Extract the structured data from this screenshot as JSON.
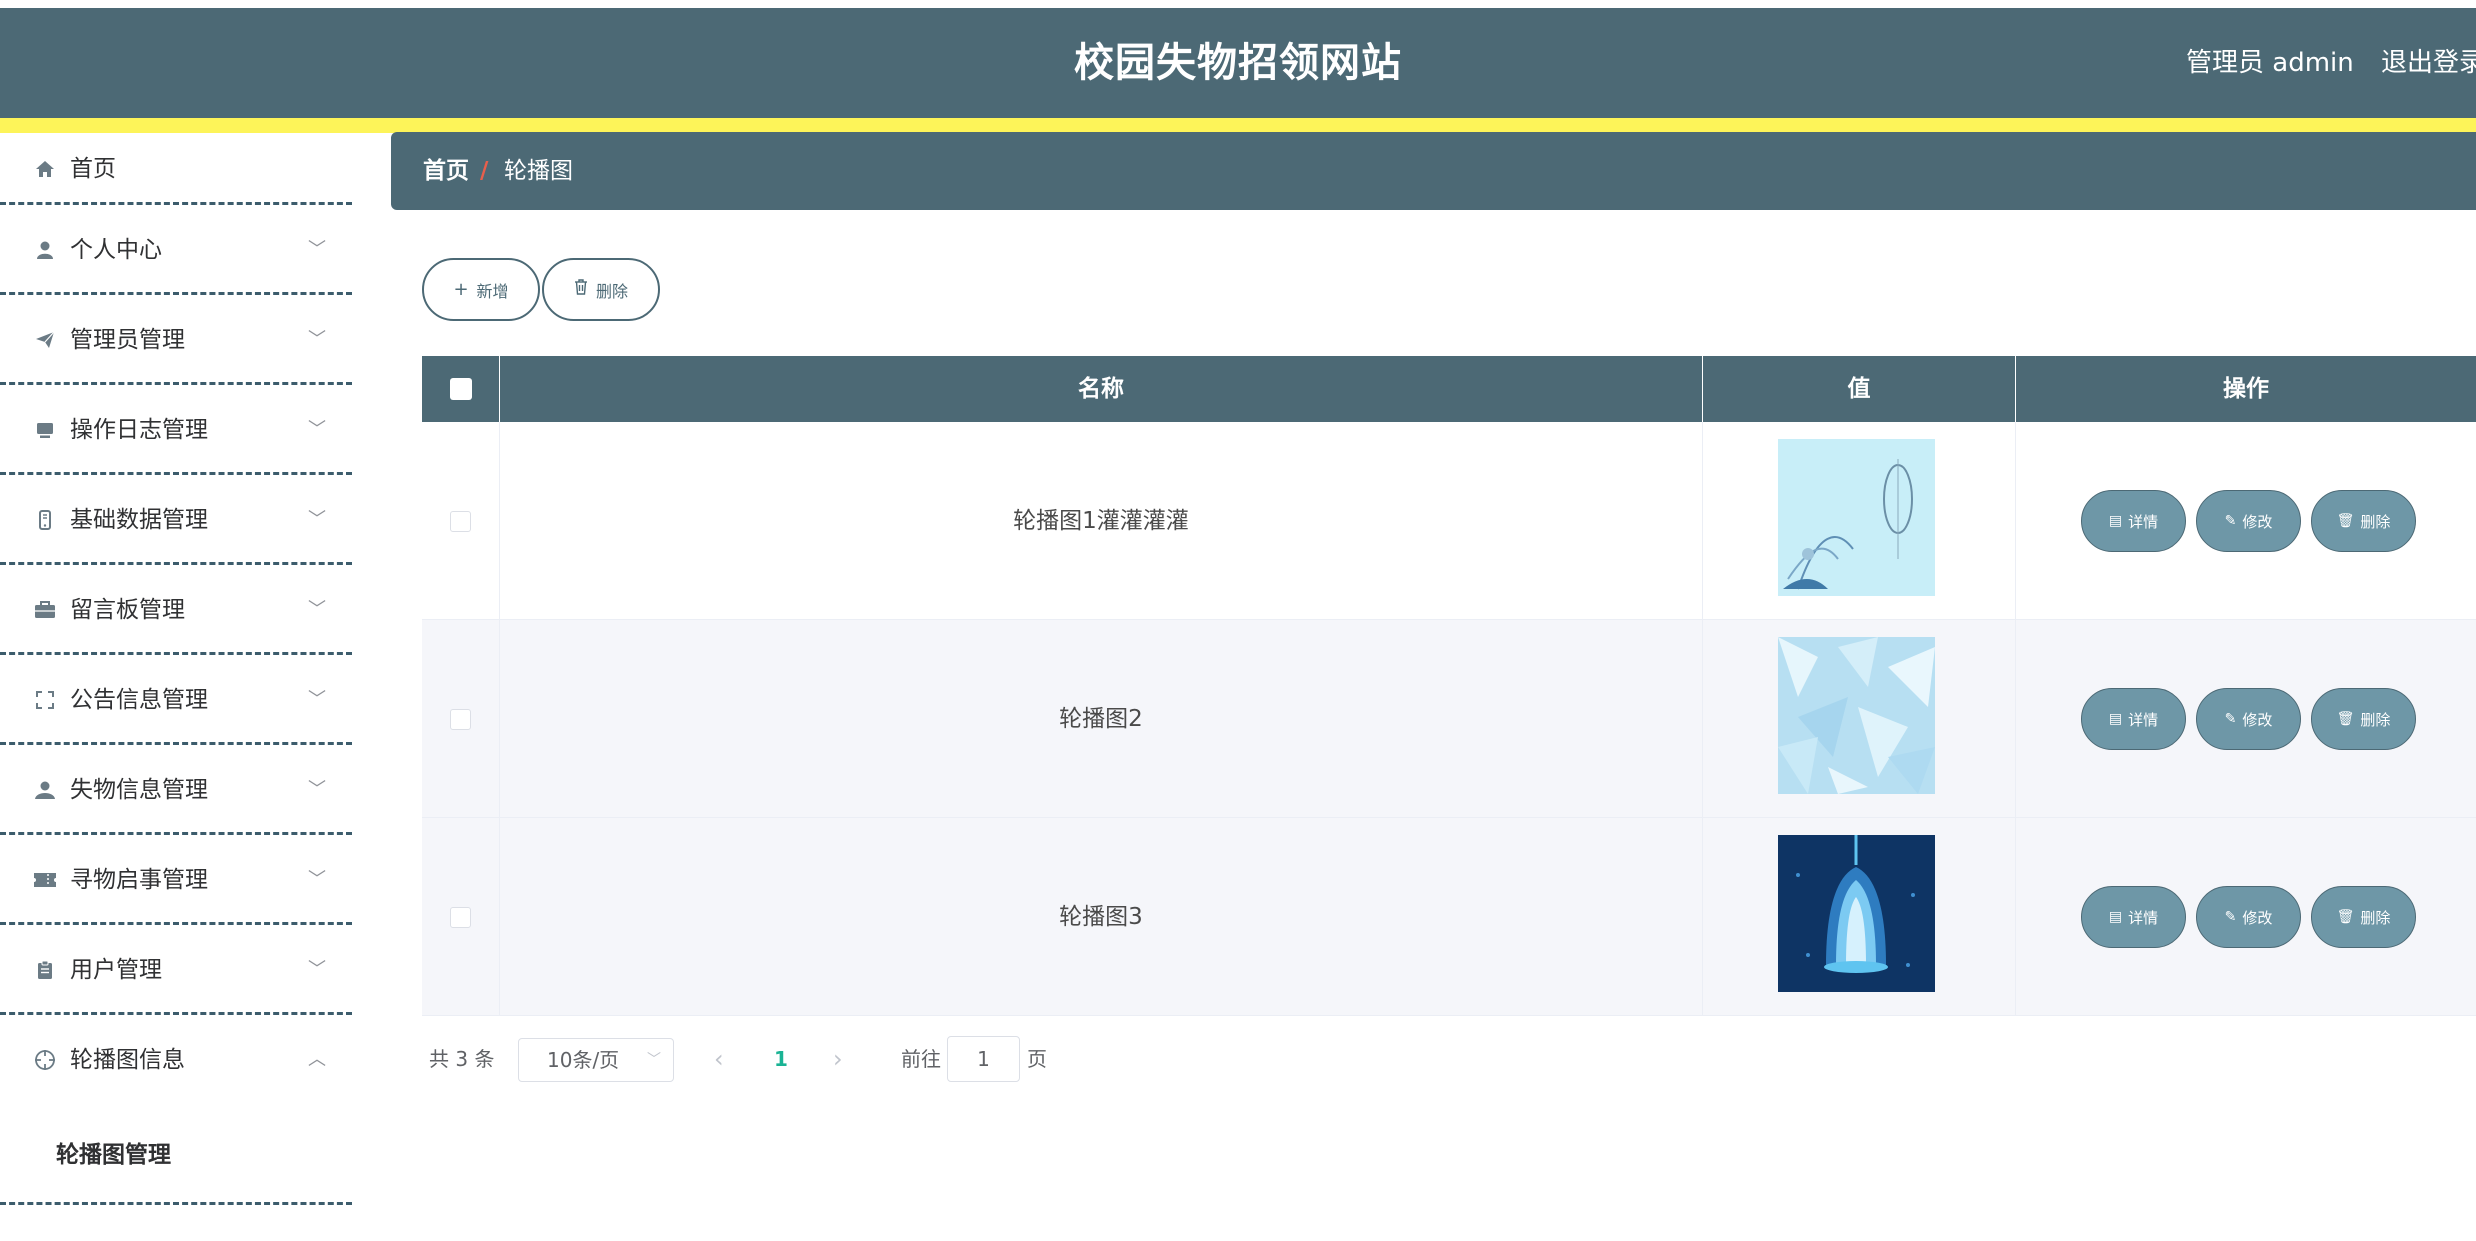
{
  "header": {
    "title": "校园失物招领网站",
    "user_label": "管理员 admin",
    "logout_label": "退出登录"
  },
  "sidebar": {
    "items": [
      {
        "label": "首页",
        "icon": "home-icon",
        "has_chevron": false
      },
      {
        "label": "个人中心",
        "icon": "user-icon",
        "has_chevron": true,
        "chevron": "﹀"
      },
      {
        "label": "管理员管理",
        "icon": "send-icon",
        "has_chevron": true,
        "chevron": "﹀"
      },
      {
        "label": "操作日志管理",
        "icon": "monitor-icon",
        "has_chevron": true,
        "chevron": "﹀"
      },
      {
        "label": "基础数据管理",
        "icon": "phone-icon",
        "has_chevron": true,
        "chevron": "﹀"
      },
      {
        "label": "留言板管理",
        "icon": "briefcase-icon",
        "has_chevron": true,
        "chevron": "﹀"
      },
      {
        "label": "公告信息管理",
        "icon": "fullscreen-icon",
        "has_chevron": true,
        "chevron": "﹀"
      },
      {
        "label": "失物信息管理",
        "icon": "person-icon",
        "has_chevron": true,
        "chevron": "﹀"
      },
      {
        "label": "寻物启事管理",
        "icon": "ticket-icon",
        "has_chevron": true,
        "chevron": "﹀"
      },
      {
        "label": "用户管理",
        "icon": "clipboard-icon",
        "has_chevron": true,
        "chevron": "﹀"
      },
      {
        "label": "轮播图信息",
        "icon": "crosshair-icon",
        "has_chevron": true,
        "chevron": "︿"
      }
    ],
    "submenu": [
      {
        "label": "轮播图管理"
      }
    ]
  },
  "breadcrumb": {
    "home": "首页",
    "separator": "/",
    "current": "轮播图"
  },
  "toolbar": {
    "add_label": "新增",
    "add_icon": "+",
    "delete_label": "删除",
    "delete_icon": "🗑"
  },
  "table": {
    "columns": [
      "名称",
      "值",
      "操作"
    ],
    "rows": [
      {
        "name": "轮播图1灌灌灌灌",
        "image": "light-blue-ornament-image"
      },
      {
        "name": "轮播图2",
        "image": "icy-blue-texture-image"
      },
      {
        "name": "轮播图3",
        "image": "dark-blue-chandelier-image"
      }
    ],
    "actions": {
      "detail": "详情",
      "detail_icon": "▤",
      "edit": "修改",
      "edit_icon": "✎",
      "delete": "删除",
      "delete_icon": "🗑"
    }
  },
  "pagination": {
    "total": "共 3 条",
    "page_size": "10条/页",
    "prev": "‹",
    "current_page": "1",
    "next": "›",
    "goto_label": "前往",
    "goto_value": "1",
    "goto_unit": "页"
  },
  "colors": {
    "primary": "#4c6975",
    "accent_stripe": "#fdf459",
    "action_button": "#6e97a7",
    "active_page": "#1ab394",
    "breadcrumb_separator": "#e75f4c"
  }
}
